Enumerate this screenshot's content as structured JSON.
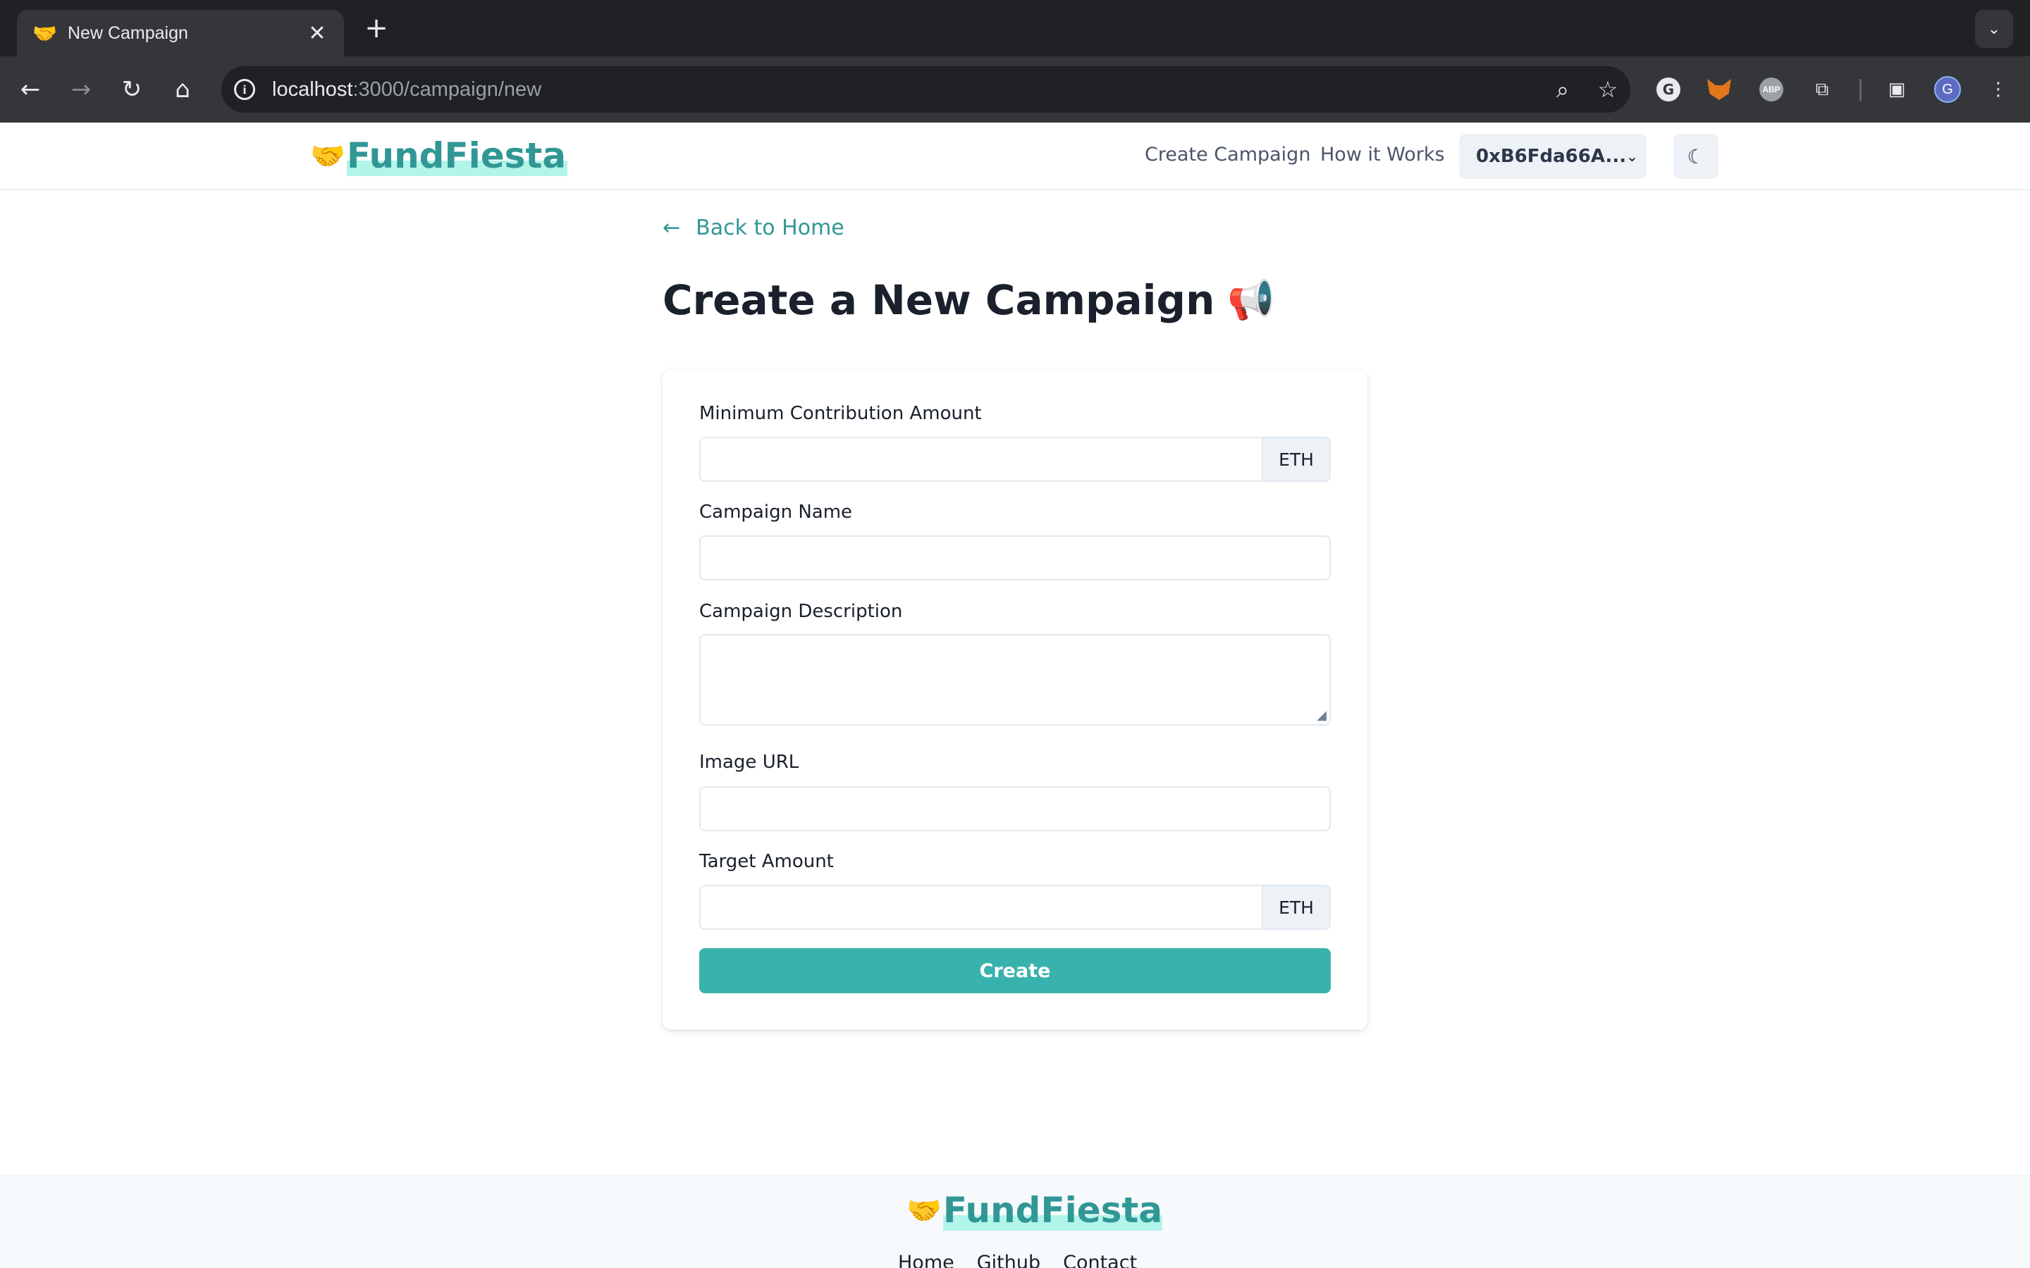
{
  "browser": {
    "tab_title": "New Campaign",
    "tab_favicon": "🤝",
    "url_host": "localhost",
    "url_path": ":3000/campaign/new",
    "profile_initial": "G",
    "abp_label": "ABP"
  },
  "header": {
    "logo_emoji": "🤝",
    "logo_text": "FundFiesta",
    "nav": {
      "create_campaign": "Create Campaign",
      "how_it_works": "How it Works"
    },
    "wallet_address": "0xB6Fda66A..."
  },
  "main": {
    "back_link": "Back to Home",
    "title": "Create a New Campaign",
    "title_emoji": "📢"
  },
  "form": {
    "min_contribution_label": "Minimum Contribution Amount",
    "min_contribution_value": "",
    "min_contribution_unit": "ETH",
    "name_label": "Campaign Name",
    "name_value": "",
    "description_label": "Campaign Description",
    "description_value": "",
    "image_url_label": "Image URL",
    "image_url_value": "",
    "target_label": "Target Amount",
    "target_value": "",
    "target_unit": "ETH",
    "submit_label": "Create"
  },
  "footer": {
    "logo_emoji": "🤝",
    "logo_text": "FundFiesta",
    "links": [
      "Home",
      "Github",
      "Contact"
    ]
  },
  "colors": {
    "brand": "#319795",
    "button": "#38b2ac",
    "chrome_dark": "#202124"
  }
}
